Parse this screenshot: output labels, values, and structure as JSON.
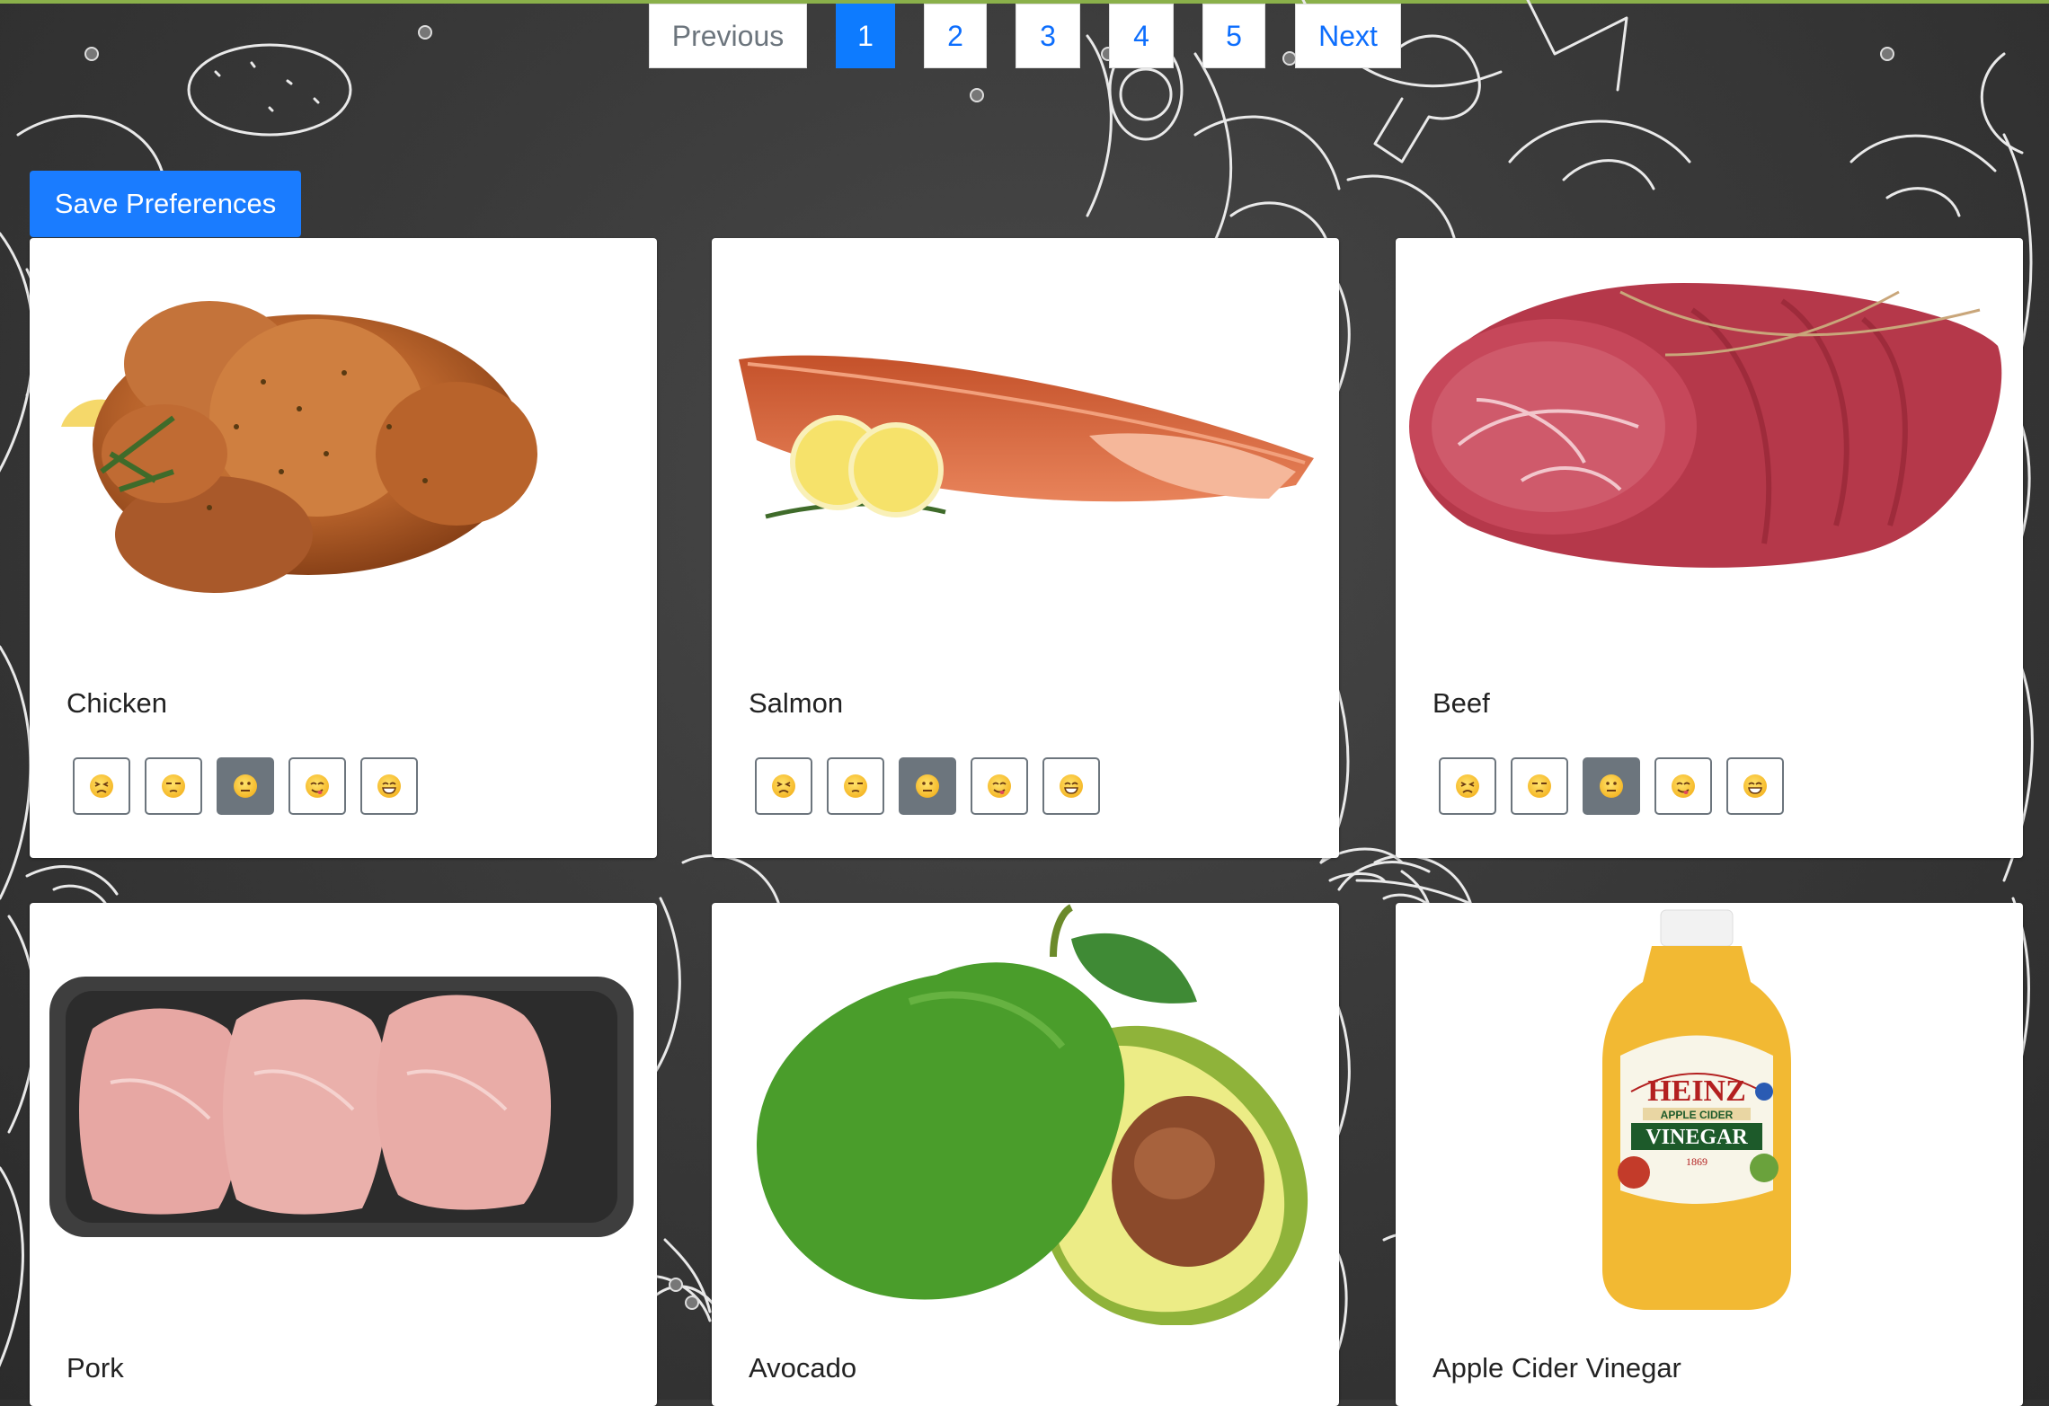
{
  "pagination": {
    "previous": "Previous",
    "pages": [
      "1",
      "2",
      "3",
      "4",
      "5"
    ],
    "active_page": "1",
    "next": "Next"
  },
  "save_label": "Save Preferences",
  "rating_icons": [
    "persevering-face-icon",
    "unamused-face-icon",
    "neutral-face-icon",
    "savoring-food-face-icon",
    "grinning-face-icon"
  ],
  "foods": [
    {
      "name": "Chicken",
      "image": "roast-chicken-image",
      "selected_rating": 3
    },
    {
      "name": "Salmon",
      "image": "salmon-fillet-image",
      "selected_rating": 3
    },
    {
      "name": "Beef",
      "image": "beef-roast-image",
      "selected_rating": 3
    },
    {
      "name": "Pork",
      "image": "pork-chops-tray-image"
    },
    {
      "name": "Avocado",
      "image": "avocado-image"
    },
    {
      "name": "Apple Cider Vinegar",
      "image": "vinegar-bottle-image",
      "label_text": {
        "brand": "HEINZ",
        "line1": "APPLE CIDER",
        "line2": "VINEGAR",
        "year": "1869"
      }
    }
  ],
  "colors": {
    "primary": "#0d7bff",
    "selected_rating": "#6c757d",
    "accent_line": "#8ab04a"
  }
}
